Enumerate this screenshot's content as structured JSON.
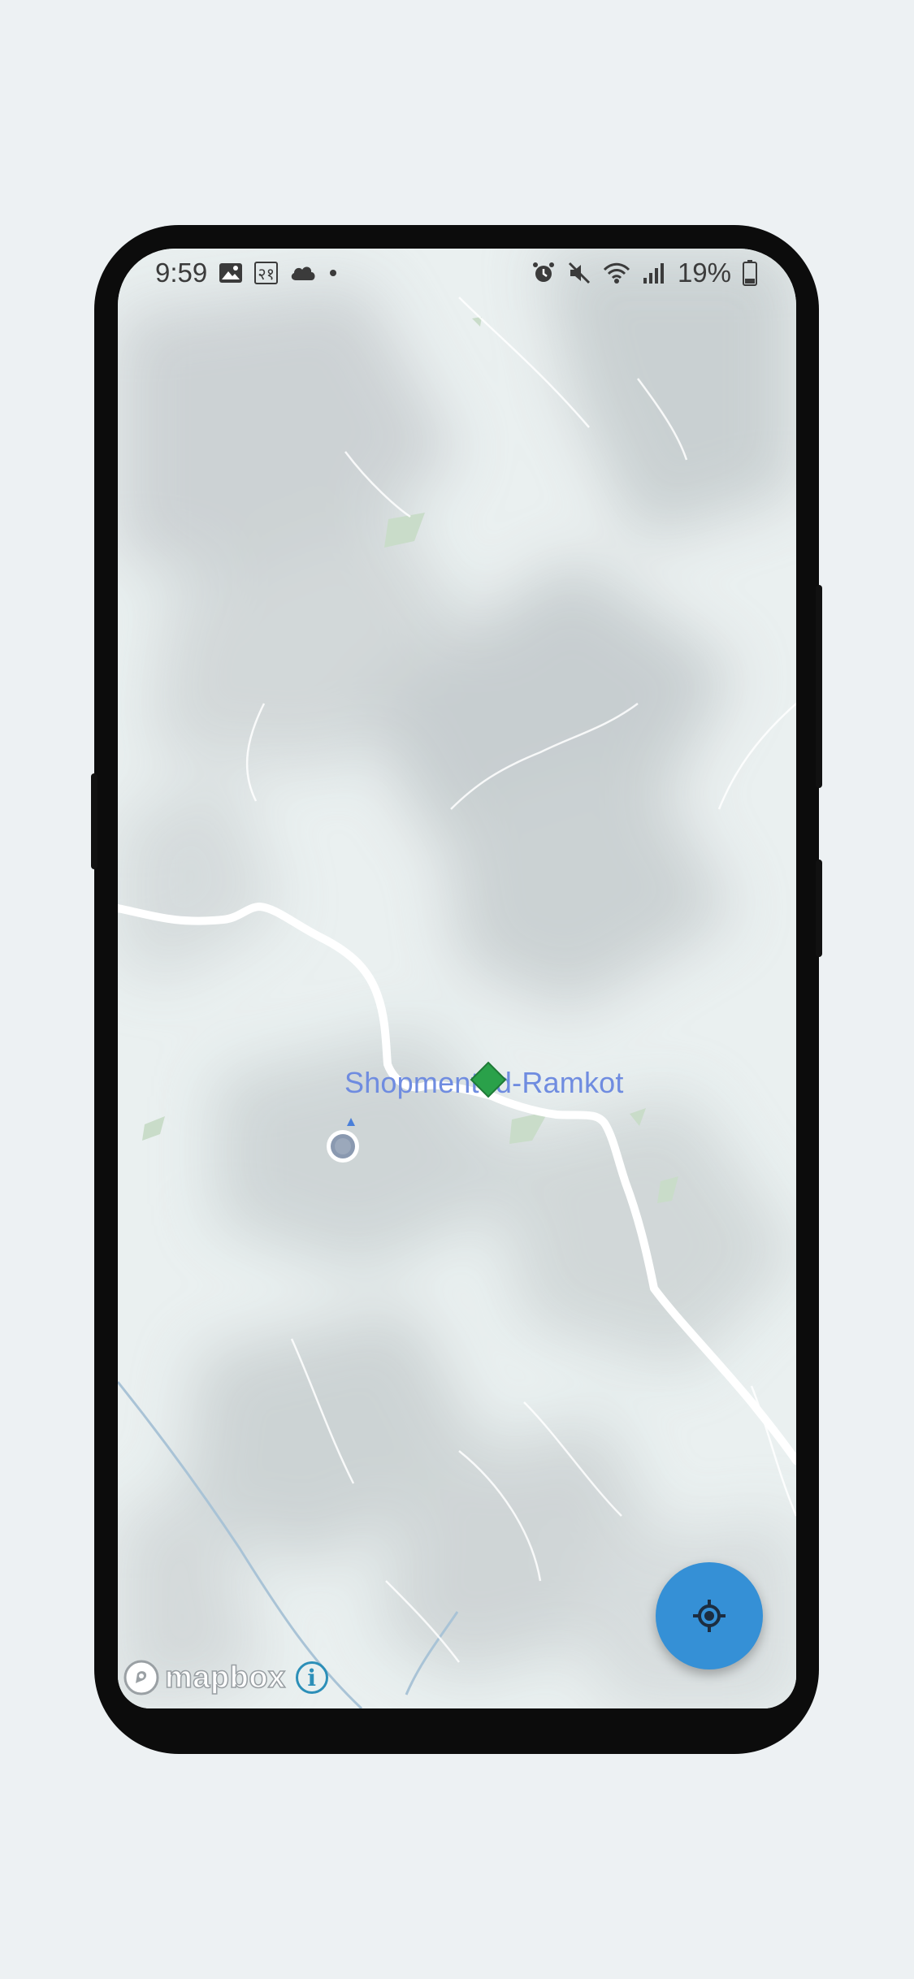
{
  "status_bar": {
    "time": "9:59",
    "notification_label": "२१",
    "battery": "19%",
    "left_icons": [
      "image-icon",
      "notification-badge-icon",
      "cloud-icon",
      "dot-icon"
    ],
    "right_icons": [
      "alarm-icon",
      "mute-icon",
      "wifi-icon",
      "signal-icon",
      "battery-icon"
    ]
  },
  "map": {
    "place_label": "Shopmented-Ramkot",
    "poi_marker_color": "#2aa14a",
    "user_location_color": "#8a99b0",
    "heading_color": "#4a7fd9",
    "road_color": "#ffffff",
    "river_color": "#a9c3d6",
    "park_color": "#c9dcc9"
  },
  "controls": {
    "recenter_button": "locate-icon",
    "fab_color": "#3590d6"
  },
  "attribution": {
    "logo_text": "mapbox",
    "info_label": "i"
  }
}
